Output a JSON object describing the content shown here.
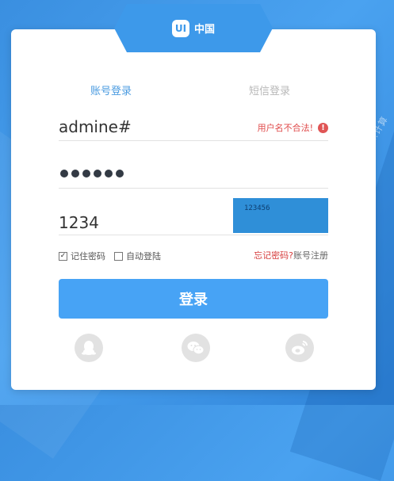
{
  "brand": {
    "logo_mark": "UI",
    "name": "中国"
  },
  "tabs": [
    {
      "label": "账号登录",
      "active": true
    },
    {
      "label": "短信登录",
      "active": false
    }
  ],
  "username": {
    "value": "admine#",
    "error": "用户名不合法!",
    "error_icon": "!"
  },
  "password": {
    "masked_length": 6
  },
  "captcha_field": {
    "value": "1234",
    "captcha_image_text": "123456"
  },
  "options": {
    "remember_label": "记住密码",
    "remember_checked": true,
    "auto_login_label": "自动登陆",
    "auto_login_checked": false,
    "forgot_label": "忘记密码?",
    "register_label": "账号注册"
  },
  "login_button": "登录",
  "social_icons": [
    "qq-icon",
    "wechat-icon",
    "weibo-icon"
  ],
  "colors": {
    "primary": "#47a3f5",
    "error": "#e04b4b",
    "tab_active": "#4a9be0",
    "tab_inactive": "#b8b8b8"
  },
  "side_text": "…计算"
}
